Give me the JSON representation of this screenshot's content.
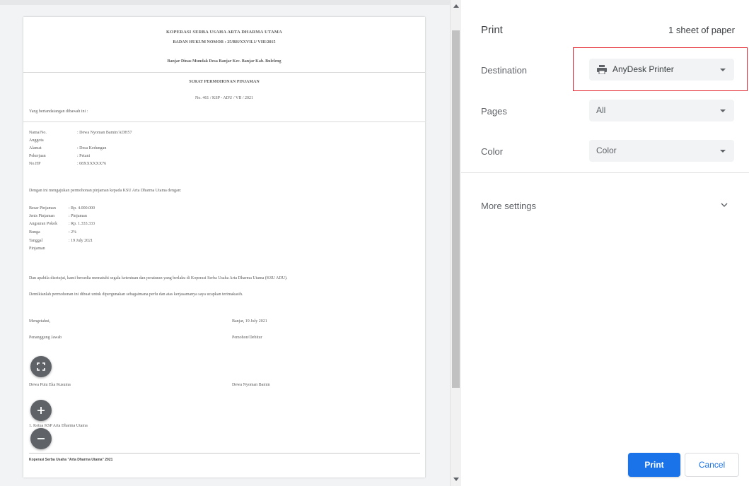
{
  "document": {
    "header_line1": "KOPERASI SERBA USAHA ARTA DHARMA UTAMA",
    "header_line2": "BADAN HUKUM NOMOR : 25/BH/XXVII.1/ VIII/2015",
    "header_line3": "Banjar Dinas Mundak Desa Banjar Kec. Banjar Kab. Buleleng",
    "doc_title": "SURAT PERMOHONAN PINJAMAN",
    "doc_number": "No. 461 / KSP - ADU / VII / 2021",
    "intro": "Yang bertandatangan dibawah ini :",
    "member_fields": [
      {
        "label": "Nama/No.",
        "value": ": Dewa Nyoman Bamin/ADH57"
      },
      {
        "label": "Anggota",
        "value": ""
      },
      {
        "label": "Alamat",
        "value": ": Desa Kedungan"
      },
      {
        "label": "Pekerjaan",
        "value": ": Petani"
      },
      {
        "label": "No.HP",
        "value": ": 08XXXXXX76"
      }
    ],
    "request_line": "Dengan ini mengajukan permohonan pinjaman kepada KSU Arta Dharma Utama dengan:",
    "loan_fields": [
      {
        "label": "Besar Pinjaman",
        "value": ": Rp. 4.000.000"
      },
      {
        "label": "Jenis Pinjaman",
        "value": ": Pinjaman"
      },
      {
        "label": "Angsuran Pokok",
        "value": ": Rp. 1.333.333"
      },
      {
        "label": "Bunga",
        "value": ": 2%"
      },
      {
        "label": "Tanggal",
        "value": ": 19 July 2021"
      },
      {
        "label": "Pinjaman",
        "value": ""
      }
    ],
    "statement_1": "Dan apabila disetujui, kami bersedia mematuhi segala ketentuan dan peraturan yang berlaku di Koperasi Serba Usaha Arta Dharma Utama (KSU ADU).",
    "statement_2": "Demikianlah permohonan ini dibuat untuk dipergunakan sebagaimana perlu dan atas kerjasamanya saya ucapkan terimakasih.",
    "sign_left_1": "Mengetahui,",
    "sign_right_1": "Banjar, 19 July 2021",
    "sign_left_2": "Penanggung Jawab",
    "sign_right_2": "Pemohon/Debitur",
    "name_left": "Dewa Putu Eka Kusuma",
    "name_right": "Dewa Nyoman Bamin",
    "cc_line": "1. Ketua KSP Arta Dharma Utama",
    "footer": "Koperasi Serba Usaha \"Arta Dharma Utama\" 2021"
  },
  "preview_controls": {
    "fit_icon": "fit-to-page-icon",
    "zoom_in_icon": "plus-icon",
    "zoom_out_icon": "minus-icon"
  },
  "sidebar": {
    "title": "Print",
    "sheet_count": "1 sheet of paper",
    "destination_label": "Destination",
    "destination_value": "AnyDesk Printer",
    "pages_label": "Pages",
    "pages_value": "All",
    "color_label": "Color",
    "color_value": "Color",
    "more_settings_label": "More settings",
    "print_button": "Print",
    "cancel_button": "Cancel"
  },
  "colors": {
    "accent": "#1a73e8",
    "highlight": "#e3262f"
  }
}
